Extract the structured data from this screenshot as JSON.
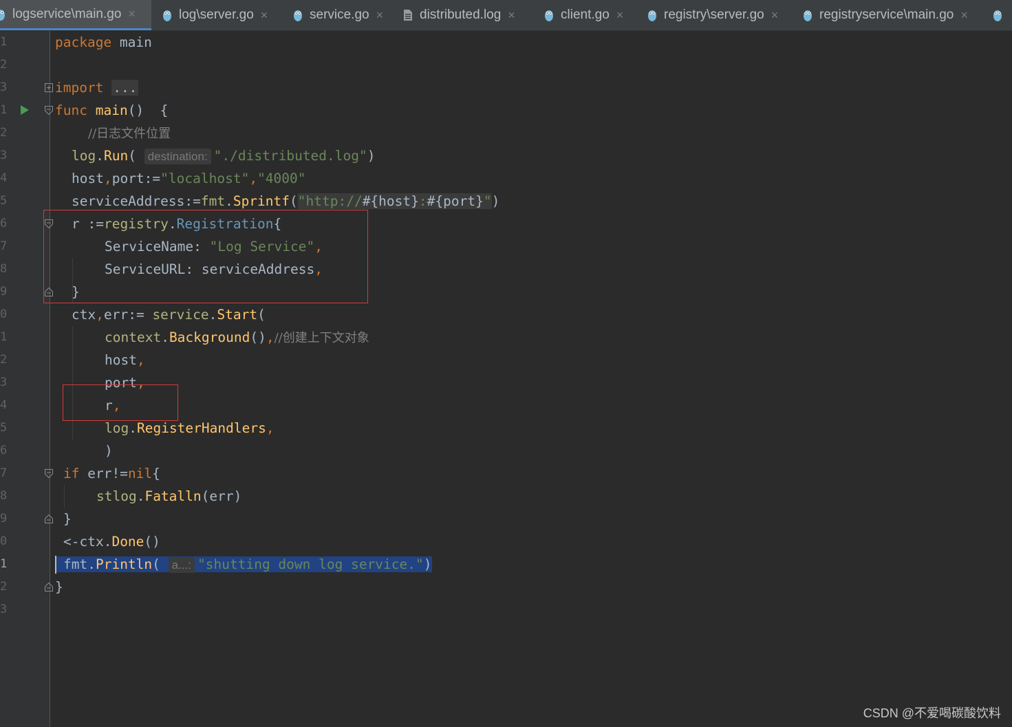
{
  "tabs": [
    {
      "label": "logservice\\main.go",
      "icon": "gopher-icon",
      "active": true
    },
    {
      "label": "log\\server.go",
      "icon": "gopher-icon"
    },
    {
      "label": "service.go",
      "icon": "gopher-icon"
    },
    {
      "label": "distributed.log",
      "icon": "file-icon"
    },
    {
      "label": "client.go",
      "icon": "gopher-icon"
    },
    {
      "label": "registry\\server.go",
      "icon": "gopher-icon"
    },
    {
      "label": "registryservice\\main.go",
      "icon": "gopher-icon"
    }
  ],
  "tab_close_glyph": "×",
  "line_numbers": [
    "1",
    "2",
    "3",
    "1",
    "2",
    "3",
    "4",
    "5",
    "6",
    "7",
    "8",
    "9",
    "0",
    "1",
    "2",
    "3",
    "4",
    "5",
    "6",
    "7",
    "8",
    "9",
    "0",
    "1",
    "2",
    "3"
  ],
  "code": {
    "l1_kw": "package",
    "l1_rest": " main",
    "l3_kw": "import",
    "l3_fold": "...",
    "l4_kw": "func",
    "l4_fn": "main",
    "l4_rest": "()  {",
    "l5_cm": "//日志文件位置",
    "l6_a": "log",
    "l6_b": ".",
    "l6_c": "Run",
    "l6_d": "(",
    "l6_hint": "destination:",
    "l6_str": "\"./distributed.log\"",
    "l6_e": ")",
    "l7_a": "host",
    "l7_b": ",",
    "l7_c": "port:=",
    "l7_s1": "\"localhost\"",
    "l7_d": ",",
    "l7_s2": "\"4000\"",
    "l8_a": "serviceAddress:=",
    "l8_b": "fmt",
    "l8_c": ".",
    "l8_d": "Sprintf",
    "l8_e": "(",
    "l8_s1": "\"http://",
    "l8_s2": "#{host}",
    "l8_s3": ":",
    "l8_s4": "#{port}",
    "l8_s5": "\"",
    "l8_f": ")",
    "l9_a": "r :=",
    "l9_b": "registry",
    "l9_c": ".",
    "l9_d": "Registration",
    "l9_e": "{",
    "l10_a": "ServiceName: ",
    "l10_s": "\"Log Service\"",
    "l10_b": ",",
    "l11_a": "ServiceURL: serviceAddress",
    "l11_b": ",",
    "l12_a": "}",
    "l13_a": "ctx",
    "l13_b": ",",
    "l13_c": "err:= ",
    "l13_d": "service",
    "l13_e": ".",
    "l13_f": "Start",
    "l13_g": "(",
    "l14_a": "context",
    "l14_b": ".",
    "l14_c": "Background",
    "l14_d": "()",
    "l14_e": ",",
    "l14_cm": "//创建上下文对象",
    "l15_a": "host",
    "l15_b": ",",
    "l16_a": "port",
    "l16_b": ",",
    "l17_a": "r",
    "l17_b": ",",
    "l18_a": "log",
    "l18_b": ".",
    "l18_c": "RegisterHandlers",
    "l18_d": ",",
    "l19_a": ")",
    "l20_kw": "if",
    "l20_a": " err!=",
    "l20_kw2": "nil",
    "l20_b": "{",
    "l21_a": "stlog",
    "l21_b": ".",
    "l21_c": "Fatalln",
    "l21_d": "(err)",
    "l22_a": "}",
    "l23_a": "<-ctx.",
    "l23_b": "Done",
    "l23_c": "()",
    "l24_a": "fmt",
    "l24_b": ".",
    "l24_c": "Println",
    "l24_d": "(",
    "l24_hint": "a...:",
    "l24_str": "\"shutting down log service.\"",
    "l24_e": ")",
    "l25_a": "}"
  },
  "watermark": "CSDN @不爱喝碳酸饮料",
  "colors": {
    "background": "#2b2b2b",
    "gutter": "#313335",
    "keyword": "#cc7832",
    "function": "#ffc66d",
    "string": "#6a8759",
    "comment": "#808080",
    "selection": "#214283",
    "annotation_box": "#d63b3b",
    "run_icon": "#499c54"
  }
}
